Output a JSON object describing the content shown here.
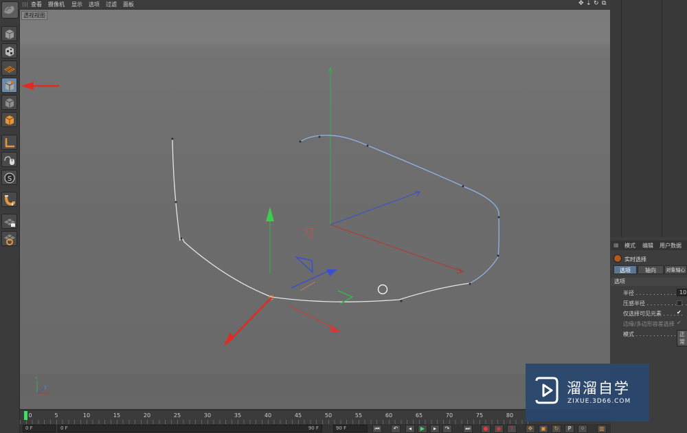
{
  "menubar": {
    "items": [
      "查看",
      "摄像机",
      "显示",
      "选项",
      "过滤",
      "面板"
    ]
  },
  "viewport": {
    "label": "透视视图"
  },
  "toolbar": {
    "buttons": [
      "cube-icon",
      "checker-cube-icon",
      "texture-grid-icon",
      "model-mode-icon",
      "point-mode-icon",
      "polygon-mode-icon",
      "axis-icon",
      "mouse-tweak-icon",
      "snap-s-icon",
      "magnet-icon",
      "workplane-lock-icon",
      "workplane-icon"
    ],
    "active_index": 3
  },
  "attributes": {
    "tabs": [
      "模式",
      "编辑",
      "用户数据"
    ],
    "title": "实时选择",
    "subtabs": [
      "选项",
      "轴向",
      "对象轴心"
    ],
    "section": "选项",
    "rows": [
      {
        "label": "半径 . . . . . . . . . . . . . .",
        "value": "10",
        "dim": false
      },
      {
        "label": "压感半径 . . . . . . . . . . . .",
        "value": "",
        "dim": false
      },
      {
        "label": "仅选择可见元素 . . . . . .",
        "value": "✔",
        "dim": false
      },
      {
        "label": "边缘/多边形容差选择",
        "value": "✔",
        "dim": true
      },
      {
        "label": "模式 . . . . . . . . . . . . . .",
        "value": "正常",
        "dim": false
      }
    ]
  },
  "timeline": {
    "ticks": [
      "0",
      "5",
      "10",
      "15",
      "20",
      "25",
      "30",
      "35",
      "40",
      "45",
      "50",
      "55",
      "60",
      "65",
      "70",
      "75",
      "80"
    ],
    "current_frame": "0 F",
    "start_field": "0 F",
    "end_field": "90 F",
    "end_field2": "90 F"
  },
  "watermark": {
    "cn": "溜溜自学",
    "en": "ZIXUE.3D66.COM"
  },
  "colors": {
    "accent": "#6d89a6",
    "axis_x": "#c8302c",
    "axis_y": "#37b34a",
    "axis_z": "#3a4fd0",
    "spline": "#e6e6e6",
    "spline_selected": "#8fb4e6"
  }
}
